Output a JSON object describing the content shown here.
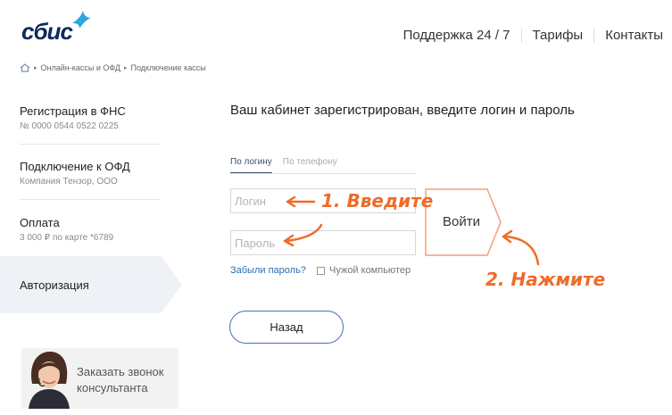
{
  "logo": {
    "text": "сбис"
  },
  "topnav": {
    "items": [
      "Поддержка 24 / 7",
      "Тарифы",
      "Контакты"
    ]
  },
  "breadcrumb": {
    "items": [
      "Онлайн-кассы и ОФД",
      "Подключение кассы"
    ]
  },
  "sidebar": {
    "steps": [
      {
        "title": "Регистрация в ФНС",
        "subtitle": "№ 0000 0544 0522 0225"
      },
      {
        "title": "Подключение к ОФД",
        "subtitle": "Компания Тензор, ООО"
      },
      {
        "title": "Оплата",
        "subtitle": "3 000 ₽ по карте *6789"
      }
    ],
    "active_step": "Авторизация",
    "callback": {
      "line1": "Заказать звонок",
      "line2": "консультанта"
    }
  },
  "main": {
    "heading": "Ваш кабинет зарегистрирован, введите логин и пароль",
    "tabs": [
      {
        "label": "По логину",
        "active": true
      },
      {
        "label": "По телефону",
        "active": false
      }
    ],
    "login_placeholder": "Логин",
    "password_placeholder": "Пароль",
    "login_button": "Войти",
    "forgot_link": "Забыли пароль?",
    "foreign_computer": "Чужой компьютер",
    "back_button": "Назад"
  },
  "annotations": {
    "step1": "1. Введите",
    "step2": "2. Нажмите",
    "color": "#ef6b29"
  }
}
